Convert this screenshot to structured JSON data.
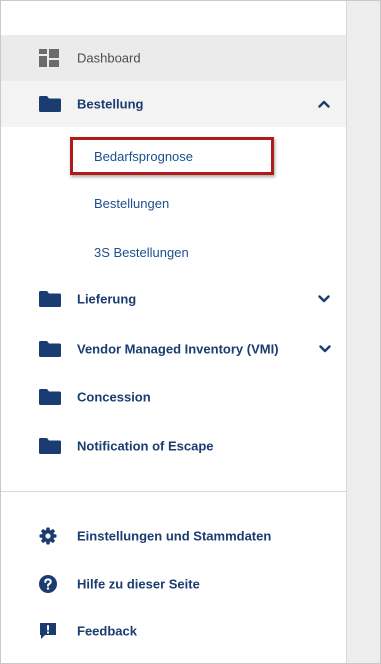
{
  "colors": {
    "accent": "#1a3c70",
    "link": "#1f4f8c",
    "highlight_border": "#b01a1a",
    "active_bg": "#ebebeb"
  },
  "nav": {
    "dashboard": {
      "label": "Dashboard",
      "icon": "dashboard-icon"
    },
    "bestellung": {
      "label": "Bestellung",
      "icon": "folder-icon",
      "expanded": true,
      "sub_items": [
        "Bedarfsprognose",
        "Bestellungen",
        "3S Bestellungen"
      ]
    },
    "lieferung": {
      "label": "Lieferung",
      "icon": "folder-icon"
    },
    "vmi": {
      "label": "Vendor Managed Inventory (VMI)",
      "icon": "folder-icon"
    },
    "concession": {
      "label": "Concession",
      "icon": "folder-icon"
    },
    "escape": {
      "label": "Notification of Escape",
      "icon": "folder-icon"
    }
  },
  "footer": {
    "settings": {
      "label": "Einstellungen und Stammdaten",
      "icon": "gear-icon"
    },
    "help": {
      "label": "Hilfe zu dieser Seite",
      "icon": "help-icon"
    },
    "feedback": {
      "label": "Feedback",
      "icon": "feedback-icon"
    }
  }
}
